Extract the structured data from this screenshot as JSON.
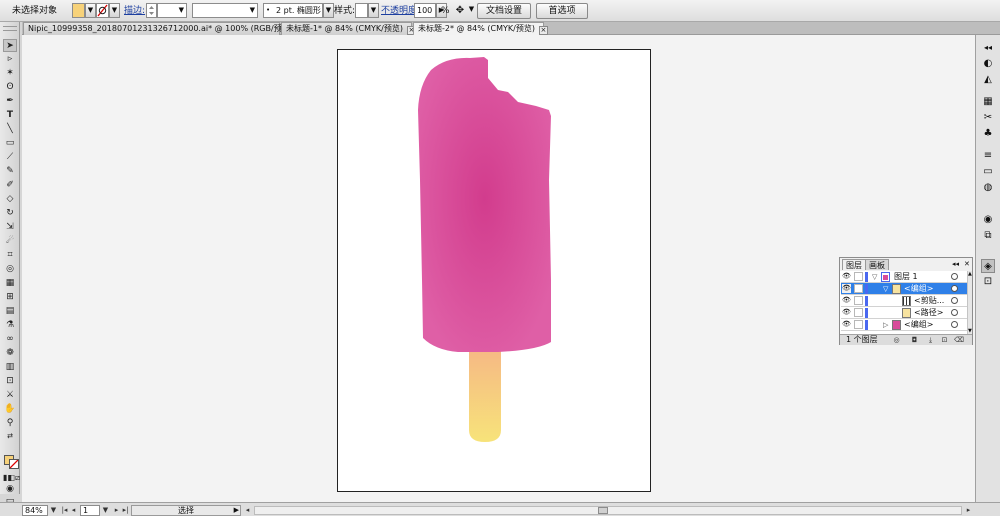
{
  "control_bar": {
    "selection_status": "未选择对象",
    "stroke_label": "描边:",
    "stroke_profile": "2 pt. 椭圆形",
    "style_label": "样式:",
    "opacity_label": "不透明度:",
    "opacity_value": "100",
    "opacity_unit": "%",
    "document_setup_button": "文档设置",
    "preferences_button": "首选项"
  },
  "tabs": [
    {
      "label": "Nipic_10999358_20180701231326712000.ai* @ 100% (RGB/预览)",
      "active": false
    },
    {
      "label": "未标题-1* @ 84% (CMYK/预览)",
      "active": false
    },
    {
      "label": "未标题-2* @ 84% (CMYK/预览)",
      "active": true
    }
  ],
  "tab_close_glyph": "×",
  "layers_panel": {
    "tabs": [
      "图层",
      "画板"
    ],
    "rows": [
      {
        "name": "图层 1",
        "level": 0,
        "expanded": true,
        "selected": false
      },
      {
        "name": "<编组>",
        "level": 1,
        "expanded": true,
        "selected": true
      },
      {
        "name": "<剪贴...",
        "level": 2,
        "expanded": false,
        "selected": false
      },
      {
        "name": "<路径>",
        "level": 2,
        "expanded": false,
        "selected": false
      },
      {
        "name": "<编组>",
        "level": 1,
        "expanded": false,
        "selected": false
      }
    ],
    "footer_count": "1 个图层"
  },
  "status_bar": {
    "zoom": "84%",
    "page": "1",
    "tool_label": "选择"
  },
  "colors": {
    "fill_swatch": "#f7d27a",
    "ice_cream_top": "#df5fa6",
    "ice_cream_center": "#d23c8d",
    "stick_top": "#f6b984",
    "stick_bottom": "#f7e37a",
    "selection_blue": "#2f80e8",
    "layer_color": "#4a68f0"
  }
}
